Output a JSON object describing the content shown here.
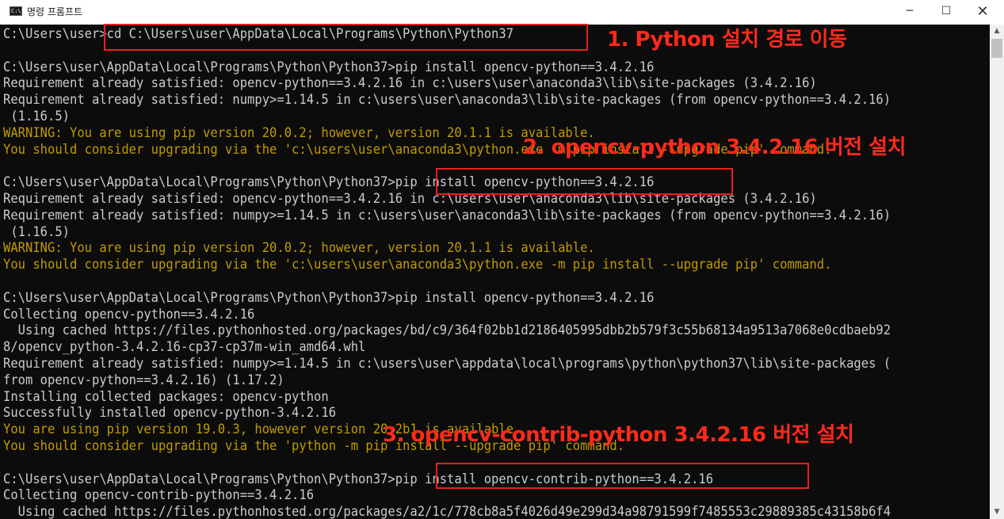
{
  "window": {
    "title": "명령 프롬프트",
    "icon": "cmd-icon",
    "controls": {
      "minimize": "─",
      "maximize": "☐",
      "close": "✕"
    }
  },
  "colors": {
    "console_bg": "#0c0c0c",
    "text": "#cccccc",
    "warning": "#c19c00",
    "annotation": "#ff2a1a"
  },
  "console": {
    "lines": [
      "C:\\Users\\user>cd C:\\Users\\user\\AppData\\Local\\Programs\\Python\\Python37",
      "",
      "C:\\Users\\user\\AppData\\Local\\Programs\\Python\\Python37>pip install opencv-python==3.4.2.16",
      "Requirement already satisfied: opencv-python==3.4.2.16 in c:\\users\\user\\anaconda3\\lib\\site-packages (3.4.2.16)",
      "Requirement already satisfied: numpy>=1.14.5 in c:\\users\\user\\anaconda3\\lib\\site-packages (from opencv-python==3.4.2.16)",
      " (1.16.5)",
      "WARNING: You are using pip version 20.0.2; however, version 20.1.1 is available.",
      "You should consider upgrading via the 'c:\\users\\user\\anaconda3\\python.exe -m pip install --upgrade pip' command.",
      "",
      "C:\\Users\\user\\AppData\\Local\\Programs\\Python\\Python37>pip install opencv-python==3.4.2.16",
      "Requirement already satisfied: opencv-python==3.4.2.16 in c:\\users\\user\\anaconda3\\lib\\site-packages (3.4.2.16)",
      "Requirement already satisfied: numpy>=1.14.5 in c:\\users\\user\\anaconda3\\lib\\site-packages (from opencv-python==3.4.2.16)",
      " (1.16.5)",
      "WARNING: You are using pip version 20.0.2; however, version 20.1.1 is available.",
      "You should consider upgrading via the 'c:\\users\\user\\anaconda3\\python.exe -m pip install --upgrade pip' command.",
      "",
      "C:\\Users\\user\\AppData\\Local\\Programs\\Python\\Python37>pip install opencv-python==3.4.2.16",
      "Collecting opencv-python==3.4.2.16",
      "  Using cached https://files.pythonhosted.org/packages/bd/c9/364f02bb1d2186405995dbb2b579f3c55b68134a9513a7068e0cdbaeb92",
      "8/opencv_python-3.4.2.16-cp37-cp37m-win_amd64.whl",
      "Requirement already satisfied: numpy>=1.14.5 in c:\\users\\user\\appdata\\local\\programs\\python\\python37\\lib\\site-packages (",
      "from opencv-python==3.4.2.16) (1.17.2)",
      "Installing collected packages: opencv-python",
      "Successfully installed opencv-python-3.4.2.16",
      "You are using pip version 19.0.3, however version 20.2b1 is available.",
      "You should consider upgrading via the 'python -m pip install --upgrade pip' command.",
      "",
      "C:\\Users\\user\\AppData\\Local\\Programs\\Python\\Python37>pip install opencv-contrib-python==3.4.2.16",
      "Collecting opencv-contrib-python==3.4.2.16",
      "  Using cached https://files.pythonhosted.org/packages/a2/1c/778cb8a5f4026d49e299d34a98791599f7485553c29889385c43158b6f4"
    ],
    "warning_line_indexes": [
      6,
      7,
      13,
      14,
      24,
      25
    ]
  },
  "annotations": [
    "1. Python 설치 경로 이동",
    "2. opencv-python 3.4.2.16 버전 설치",
    "3. opencv-contrib-python 3.4.2.16 버전 설치"
  ]
}
